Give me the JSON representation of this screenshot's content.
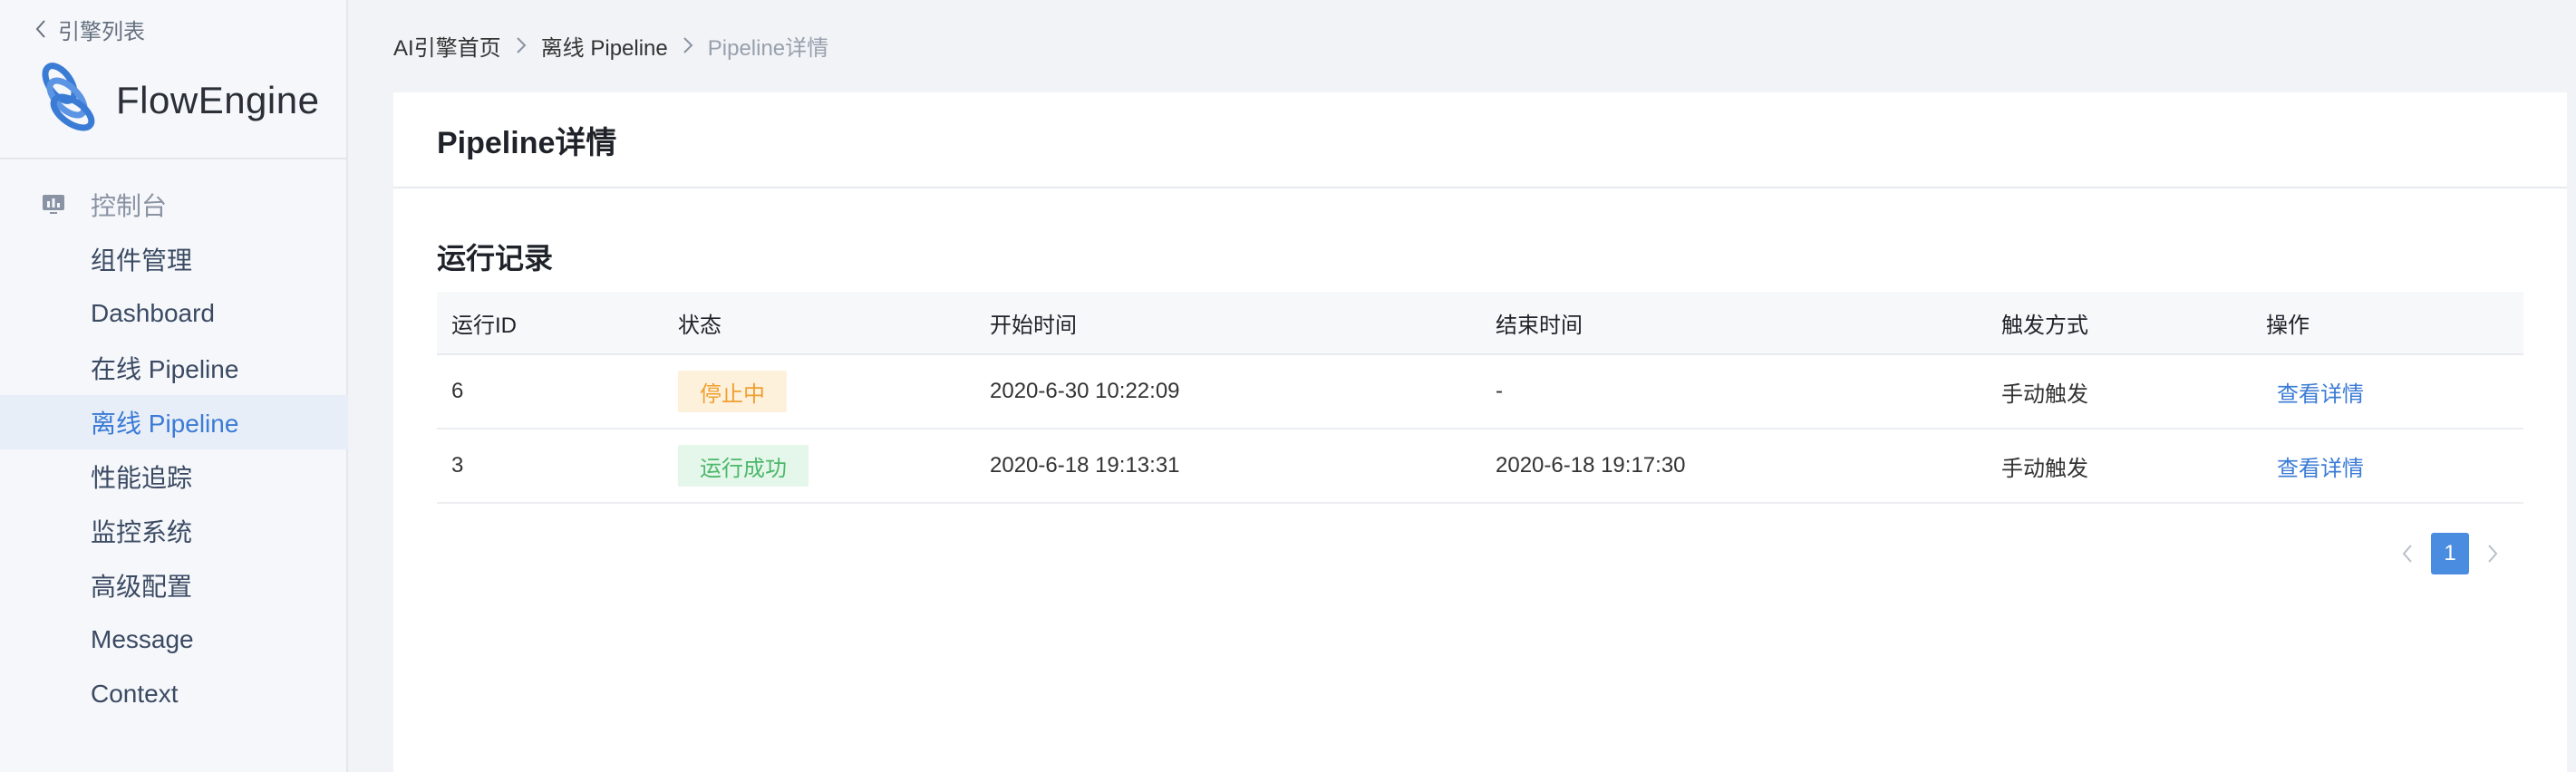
{
  "sidebar": {
    "back_label": "引擎列表",
    "logo": {
      "name_flow": "Flow",
      "name_engine": "Engine"
    },
    "group": {
      "label": "控制台",
      "icon": "dashboard-monitor-icon"
    },
    "items": [
      {
        "label": "组件管理",
        "active": false
      },
      {
        "label": "Dashboard",
        "active": false
      },
      {
        "label": "在线 Pipeline",
        "active": false
      },
      {
        "label": "离线 Pipeline",
        "active": true
      },
      {
        "label": "性能追踪",
        "active": false
      },
      {
        "label": "监控系统",
        "active": false
      },
      {
        "label": "高级配置",
        "active": false
      },
      {
        "label": "Message",
        "active": false
      },
      {
        "label": "Context",
        "active": false
      }
    ]
  },
  "breadcrumb": {
    "items": [
      "AI引擎首页",
      "离线 Pipeline",
      "Pipeline详情"
    ]
  },
  "page": {
    "title": "Pipeline详情",
    "section_title": "运行记录"
  },
  "table": {
    "columns": [
      "运行ID",
      "状态",
      "开始时间",
      "结束时间",
      "触发方式",
      "操作"
    ],
    "rows": [
      {
        "id": "6",
        "status": "停止中",
        "status_type": "stopping",
        "start": "2020-6-30 10:22:09",
        "end": "-",
        "trigger": "手动触发",
        "action": "查看详情"
      },
      {
        "id": "3",
        "status": "运行成功",
        "status_type": "success",
        "start": "2020-6-18 19:13:31",
        "end": "2020-6-18 19:17:30",
        "trigger": "手动触发",
        "action": "查看详情"
      }
    ]
  },
  "pagination": {
    "current": "1"
  },
  "colors": {
    "accent": "#3a7bd5",
    "stopping_bg": "#fdf1dc",
    "stopping_text": "#f0a030",
    "success_bg": "#e5f6ea",
    "success_text": "#4cb86b"
  }
}
